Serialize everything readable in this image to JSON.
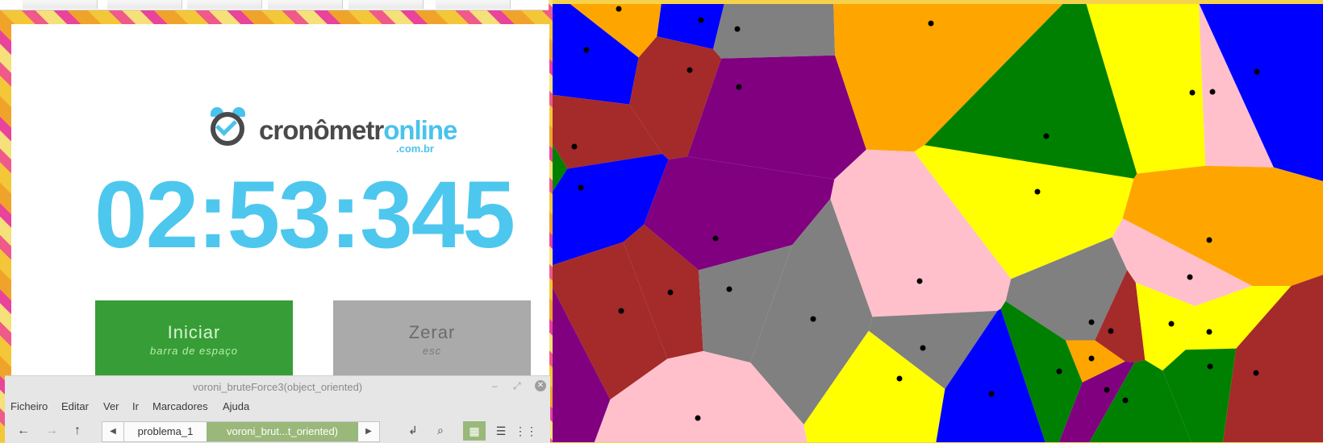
{
  "timer": {
    "brand_dark": "cronômetr",
    "brand_light": "online",
    "domain": ".com.br",
    "display": "02:53:345",
    "start_label": "Iniciar",
    "start_hint": "barra de espaço",
    "reset_label": "Zerar",
    "reset_hint": "esc",
    "colors": {
      "accent": "#4ec7ee",
      "start": "#379d37",
      "reset": "#aaaaaa"
    }
  },
  "file_manager": {
    "title": "voroni_bruteForce3(object_oriented)",
    "menu": [
      "Ficheiro",
      "Editar",
      "Ver",
      "Ir",
      "Marcadores",
      "Ajuda"
    ],
    "breadcrumbs": [
      "problema_1",
      "voroni_brut...t_oriented)"
    ],
    "icons": [
      "back-arrow-icon",
      "forward-arrow-icon",
      "up-arrow-icon",
      "path-toggle-icon",
      "search-icon",
      "grid-view-icon",
      "list-view-icon",
      "compact-view-icon",
      "close-icon"
    ]
  },
  "voronoi": {
    "palette": [
      "#0000ff",
      "#ffa500",
      "#a52a2a",
      "#808080",
      "#800080",
      "#008000",
      "#ffc0cb",
      "#ffff00"
    ],
    "site_color": "#000000"
  }
}
